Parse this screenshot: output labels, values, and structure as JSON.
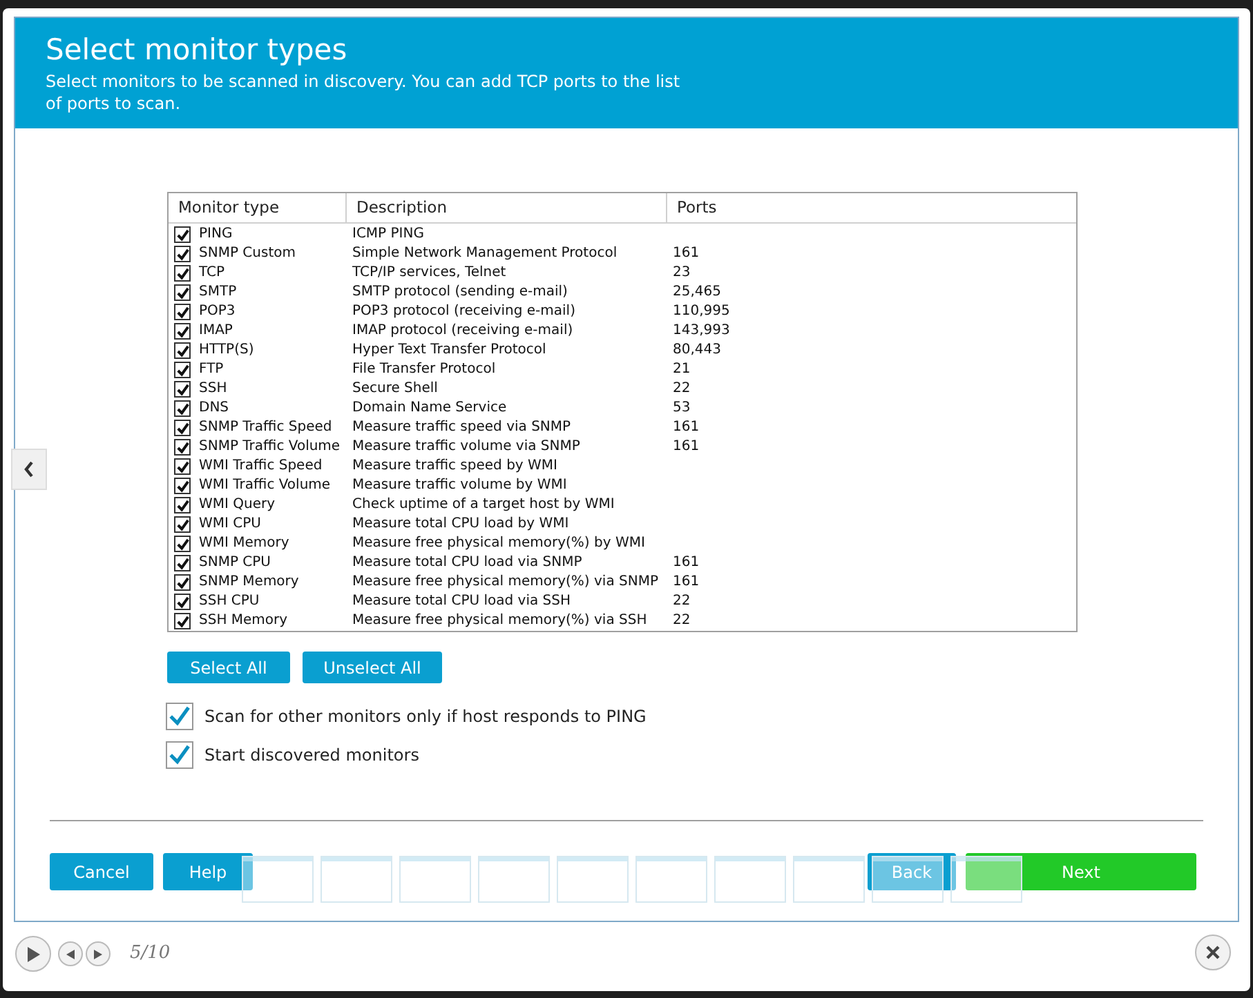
{
  "header": {
    "title": "Select monitor types",
    "subtitle": "Select monitors to be scanned in discovery. You can add TCP ports to the list of ports to scan."
  },
  "table": {
    "columns": [
      "Monitor type",
      "Description",
      "Ports"
    ],
    "rows": [
      {
        "checked": true,
        "type": "PING",
        "description": "ICMP PING",
        "ports": ""
      },
      {
        "checked": true,
        "type": "SNMP Custom",
        "description": "Simple Network Management Protocol",
        "ports": "161"
      },
      {
        "checked": true,
        "type": "TCP",
        "description": "TCP/IP services, Telnet",
        "ports": "23"
      },
      {
        "checked": true,
        "type": "SMTP",
        "description": "SMTP protocol (sending e-mail)",
        "ports": "25,465"
      },
      {
        "checked": true,
        "type": "POP3",
        "description": "POP3 protocol (receiving e-mail)",
        "ports": "110,995"
      },
      {
        "checked": true,
        "type": "IMAP",
        "description": "IMAP protocol (receiving e-mail)",
        "ports": "143,993"
      },
      {
        "checked": true,
        "type": "HTTP(S)",
        "description": "Hyper Text Transfer Protocol",
        "ports": "80,443"
      },
      {
        "checked": true,
        "type": "FTP",
        "description": "File Transfer Protocol",
        "ports": "21"
      },
      {
        "checked": true,
        "type": "SSH",
        "description": "Secure Shell",
        "ports": "22"
      },
      {
        "checked": true,
        "type": "DNS",
        "description": "Domain Name Service",
        "ports": "53"
      },
      {
        "checked": true,
        "type": "SNMP Traffic Speed",
        "description": "Measure traffic speed via SNMP",
        "ports": "161"
      },
      {
        "checked": true,
        "type": "SNMP Traffic Volume",
        "description": "Measure traffic volume via SNMP",
        "ports": "161"
      },
      {
        "checked": true,
        "type": "WMI Traffic Speed",
        "description": "Measure traffic speed by WMI",
        "ports": ""
      },
      {
        "checked": true,
        "type": "WMI Traffic Volume",
        "description": "Measure traffic volume by WMI",
        "ports": ""
      },
      {
        "checked": true,
        "type": "WMI Query",
        "description": "Check uptime of a target host by WMI",
        "ports": ""
      },
      {
        "checked": true,
        "type": "WMI CPU",
        "description": "Measure total CPU load by WMI",
        "ports": ""
      },
      {
        "checked": true,
        "type": "WMI Memory",
        "description": "Measure free physical memory(%) by WMI",
        "ports": ""
      },
      {
        "checked": true,
        "type": "SNMP CPU",
        "description": "Measure total CPU load via SNMP",
        "ports": "161"
      },
      {
        "checked": true,
        "type": "SNMP Memory",
        "description": "Measure free physical memory(%) via SNMP",
        "ports": "161"
      },
      {
        "checked": true,
        "type": "SSH CPU",
        "description": "Measure total CPU load via SSH",
        "ports": "22"
      },
      {
        "checked": true,
        "type": "SSH Memory",
        "description": "Measure free physical memory(%) via SSH",
        "ports": "22"
      }
    ]
  },
  "select_buttons": [
    "Select All",
    "Unselect All"
  ],
  "options": [
    {
      "label": "Scan for other monitors only if host responds to PING",
      "checked": true
    },
    {
      "label": "Start discovered monitors",
      "checked": true
    }
  ],
  "footer_buttons": [
    {
      "label": "Cancel",
      "kind": "normal"
    },
    {
      "label": "Help",
      "kind": "normal"
    },
    {
      "label": "Back",
      "kind": "normal"
    },
    {
      "label": "Next",
      "kind": "primary"
    }
  ],
  "player": {
    "counter": "5/10"
  }
}
